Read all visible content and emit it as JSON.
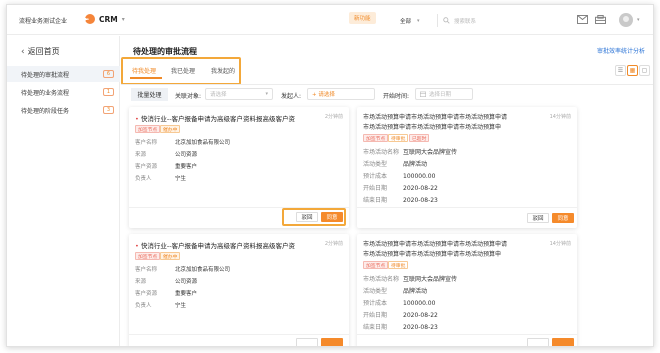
{
  "header": {
    "company": "流程业务测试企业",
    "app_name": "CRM",
    "new_badge": "新功能",
    "search_scope": "全部",
    "search_placeholder": "搜索联系",
    "icons": [
      "mail-icon",
      "inbox-icon",
      "avatar",
      "chevron-down-icon"
    ]
  },
  "sidebar": {
    "back_label": "返回首页",
    "items": [
      {
        "label": "待处理的审批流程",
        "count": "6",
        "active": true
      },
      {
        "label": "待处理的业务流程",
        "count": "1",
        "active": false
      },
      {
        "label": "待处理的阶段任务",
        "count": "3",
        "active": false
      }
    ]
  },
  "main": {
    "title": "待处理的审批流程",
    "stats_link": "审批效率统计分析",
    "tabs": [
      {
        "label": "待我处理",
        "active": true
      },
      {
        "label": "我已处理",
        "active": false
      },
      {
        "label": "我发起的",
        "active": false
      }
    ],
    "filters": {
      "batch_button": "批量处理",
      "related_label": "关联对象:",
      "related_placeholder": "请选择",
      "initiator_label": "发起人:",
      "initiator_placeholder": "+ 请选择",
      "start_label": "开始时间:",
      "start_placeholder": "选择日期"
    }
  },
  "cards": [
    {
      "title": "快消行业--客户报备申请为高级客户资料报高级客户资",
      "time": "2分钟前",
      "tags": [
        "加签节点",
        "催办中"
      ],
      "fields": [
        {
          "k": "客户名称",
          "v": "北京加加食品有限公司"
        },
        {
          "k": "来源",
          "v": "公司资源"
        },
        {
          "k": "客户资源",
          "v": "重要客户"
        },
        {
          "k": "负责人",
          "v": "宁生"
        }
      ],
      "back": "驳回",
      "ok": "同意"
    },
    {
      "title_line1": "市场活动预算申请市场活动预算申请市场活动预算申请",
      "title_line2": "市场活动预算申请市场活动预算申请市场活动预算申",
      "time": "14分钟前",
      "tags": [
        "加签节点",
        "待审批",
        "已超时"
      ],
      "fields": [
        {
          "k": "市场活动名称",
          "v": "互联网大会品牌宣传"
        },
        {
          "k": "活动类型",
          "v": "品牌活动"
        },
        {
          "k": "预计成本",
          "v": "100000.00"
        },
        {
          "k": "开始日期",
          "v": "2020-08-22"
        },
        {
          "k": "结束日期",
          "v": "2020-08-23"
        }
      ],
      "back": "驳回",
      "ok": "同意"
    },
    {
      "title": "快消行业--客户报备申请为高级客户资料报高级客户资",
      "time": "2分钟前",
      "tags": [
        "加签节点",
        "催办中"
      ],
      "fields": [
        {
          "k": "客户名称",
          "v": "北京加加食品有限公司"
        },
        {
          "k": "来源",
          "v": "公司资源"
        },
        {
          "k": "客户资源",
          "v": "重要客户"
        },
        {
          "k": "负责人",
          "v": "宁生"
        }
      ]
    },
    {
      "title_line1": "市场活动预算申请市场活动预算申请市场活动预算申请",
      "title_line2": "市场活动预算申请市场活动预算申请市场活动预算申",
      "time": "14分钟前",
      "tags": [
        "加签节点",
        "待审批"
      ],
      "fields": [
        {
          "k": "市场活动名称",
          "v": "互联网大会品牌宣传"
        },
        {
          "k": "活动类型",
          "v": "品牌活动"
        },
        {
          "k": "预计成本",
          "v": "100000.00"
        },
        {
          "k": "开始日期",
          "v": "2020-08-22"
        },
        {
          "k": "结束日期",
          "v": "2020-08-23"
        }
      ]
    }
  ],
  "colors": {
    "accent": "#f58a2b",
    "link": "#2a73d6",
    "highlight": "#f3a83a"
  }
}
